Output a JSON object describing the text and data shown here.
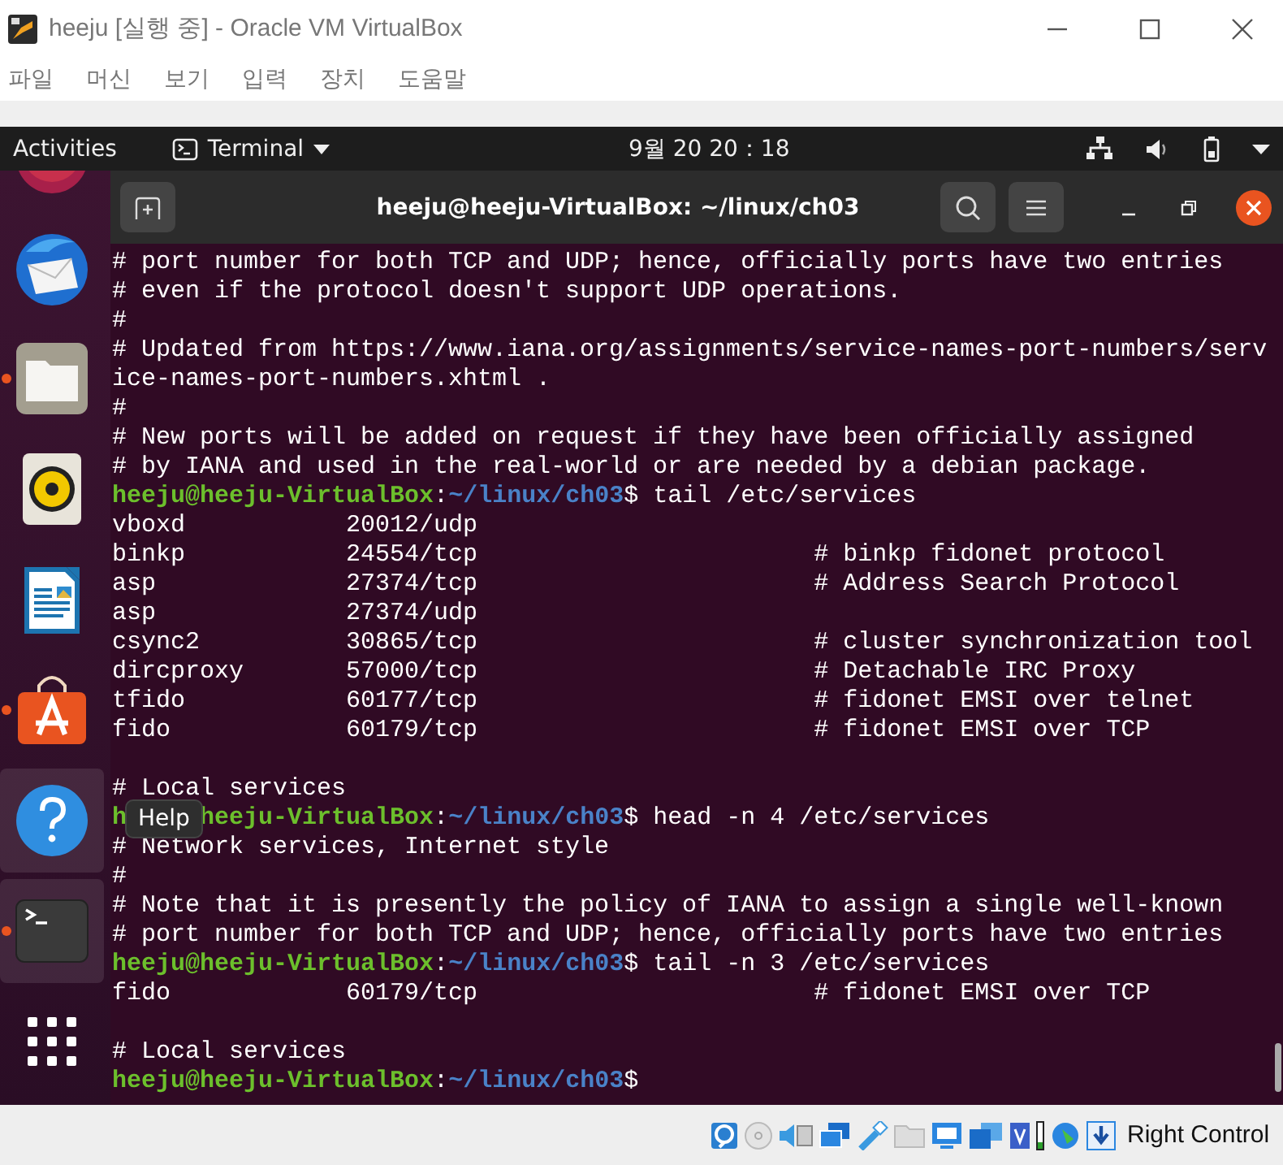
{
  "window": {
    "title": "heeju [실행 중] - Oracle VM VirtualBox"
  },
  "menu": [
    "파일",
    "머신",
    "보기",
    "입력",
    "장치",
    "도움말"
  ],
  "top_bar": {
    "activities": "Activities",
    "app_menu": "Terminal",
    "clock": "9월 20  20：18"
  },
  "dock": {
    "items": [
      {
        "kind": "partial",
        "running": false,
        "highlighted": false
      },
      {
        "kind": "mail",
        "running": false,
        "highlighted": false
      },
      {
        "kind": "files",
        "running": true,
        "highlighted": false
      },
      {
        "kind": "speaker",
        "running": false,
        "highlighted": false
      },
      {
        "kind": "writer",
        "running": false,
        "highlighted": false
      },
      {
        "kind": "store",
        "running": true,
        "highlighted": false
      },
      {
        "kind": "help",
        "running": false,
        "highlighted": true
      },
      {
        "kind": "terminal",
        "running": true,
        "highlighted": true
      },
      {
        "kind": "grid",
        "running": false,
        "highlighted": false
      }
    ],
    "tooltip": "Help"
  },
  "terminal": {
    "title": "heeju@heeju-VirtualBox: ~/linux/ch03",
    "lines": [
      {
        "kind": "text",
        "text": "# port number for both TCP and UDP; hence, officially ports have two entries"
      },
      {
        "kind": "text",
        "text": "# even if the protocol doesn't support UDP operations."
      },
      {
        "kind": "text",
        "text": "#"
      },
      {
        "kind": "text",
        "text": "# Updated from https://www.iana.org/assignments/service-names-port-numbers/serv"
      },
      {
        "kind": "text",
        "text": "ice-names-port-numbers.xhtml ."
      },
      {
        "kind": "text",
        "text": "#"
      },
      {
        "kind": "text",
        "text": "# New ports will be added on request if they have been officially assigned"
      },
      {
        "kind": "text",
        "text": "# by IANA and used in the real-world or are needed by a debian package."
      },
      {
        "kind": "prompt",
        "user": "heeju@heeju-VirtualBox",
        "sep": ":",
        "path": "~/linux/ch03",
        "sign": "$",
        "command": " tail /etc/services"
      },
      {
        "kind": "service",
        "name": "vboxd",
        "port": "20012/udp"
      },
      {
        "kind": "service",
        "name": "binkp",
        "port": "24554/tcp",
        "comment": "# binkp fidonet protocol"
      },
      {
        "kind": "service",
        "name": "asp",
        "port": "27374/tcp",
        "comment": "# Address Search Protocol"
      },
      {
        "kind": "service",
        "name": "asp",
        "port": "27374/udp"
      },
      {
        "kind": "service",
        "name": "csync2",
        "port": "30865/tcp",
        "comment": "# cluster synchronization tool"
      },
      {
        "kind": "service",
        "name": "dircproxy",
        "port": "57000/tcp",
        "comment": "# Detachable IRC Proxy"
      },
      {
        "kind": "service",
        "name": "tfido",
        "port": "60177/tcp",
        "comment": "# fidonet EMSI over telnet"
      },
      {
        "kind": "service",
        "name": "fido",
        "port": "60179/tcp",
        "comment": "# fidonet EMSI over TCP"
      },
      {
        "kind": "blank"
      },
      {
        "kind": "text",
        "text": "# Local services"
      },
      {
        "kind": "prompt",
        "lead": "h",
        "user": "heeju-VirtualBox",
        "sep": ":",
        "path": "~/linux/ch03",
        "sign": "$",
        "command": " head -n 4 /etc/services"
      },
      {
        "kind": "text",
        "text": "# Network services, Internet style"
      },
      {
        "kind": "text",
        "text": "#"
      },
      {
        "kind": "text",
        "text": "# Note that it is presently the policy of IANA to assign a single well-known"
      },
      {
        "kind": "text",
        "text": "# port number for both TCP and UDP; hence, officially ports have two entries"
      },
      {
        "kind": "prompt",
        "user": "heeju@heeju-VirtualBox",
        "sep": ":",
        "path": "~/linux/ch03",
        "sign": "$",
        "command": " tail -n 3 /etc/services"
      },
      {
        "kind": "service",
        "name": "fido",
        "port": "60179/tcp",
        "comment": "# fidonet EMSI over TCP"
      },
      {
        "kind": "blank"
      },
      {
        "kind": "text",
        "text": "# Local services"
      },
      {
        "kind": "prompt",
        "user": "heeju@heeju-VirtualBox",
        "sep": ":",
        "path": "~/linux/ch03",
        "sign": "$"
      }
    ]
  },
  "status_bar": {
    "host_key": "Right Control"
  }
}
